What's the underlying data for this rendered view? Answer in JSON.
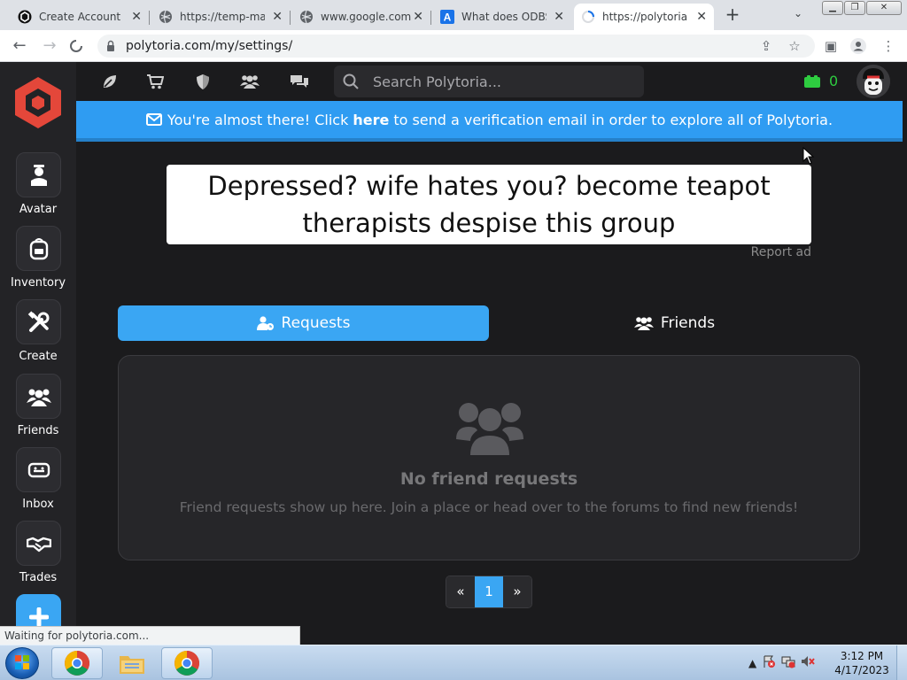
{
  "browser": {
    "tabs": [
      {
        "title": "Create Account",
        "icon": "polytoria-favicon"
      },
      {
        "title": "https://temp-mail",
        "icon": "globe-icon"
      },
      {
        "title": "www.google.com",
        "icon": "globe-icon"
      },
      {
        "title": "What does ODBS",
        "icon": "ask-favicon"
      },
      {
        "title": "https://polytoria.c",
        "icon": "loading-spinner",
        "active": true
      }
    ],
    "url": "polytoria.com/my/settings/",
    "status_text": "Waiting for polytoria.com..."
  },
  "site": {
    "search_placeholder": "Search Polytoria...",
    "currency_amount": "0",
    "sidebar": [
      {
        "label": "Avatar",
        "icon": "avatar-icon"
      },
      {
        "label": "Inventory",
        "icon": "backpack-icon"
      },
      {
        "label": "Create",
        "icon": "tools-icon"
      },
      {
        "label": "Friends",
        "icon": "friends-icon"
      },
      {
        "label": "Inbox",
        "icon": "inbox-icon"
      },
      {
        "label": "Trades",
        "icon": "handshake-icon"
      }
    ],
    "banner": {
      "pre": "You're almost there! Click",
      "link": "here",
      "post": "to send a verification email in order to explore all of Polytoria."
    },
    "ad": {
      "line1": "Depressed? wife hates you? become teapot",
      "line2": "therapists despise this group",
      "report": "Report ad"
    },
    "tabs": {
      "requests": "Requests",
      "friends": "Friends"
    },
    "empty": {
      "title": "No friend requests",
      "description": "Friend requests show up here. Join a place or head over to the forums to find new friends!"
    },
    "pager": {
      "prev": "«",
      "current": "1",
      "next": "»"
    }
  },
  "taskbar": {
    "time": "3:12 PM",
    "date": "4/17/2023"
  },
  "colors": {
    "accent": "#3aa6f3",
    "brand_red": "#e4473a",
    "currency_green": "#2ecc40",
    "background": "#1b1b1d"
  }
}
